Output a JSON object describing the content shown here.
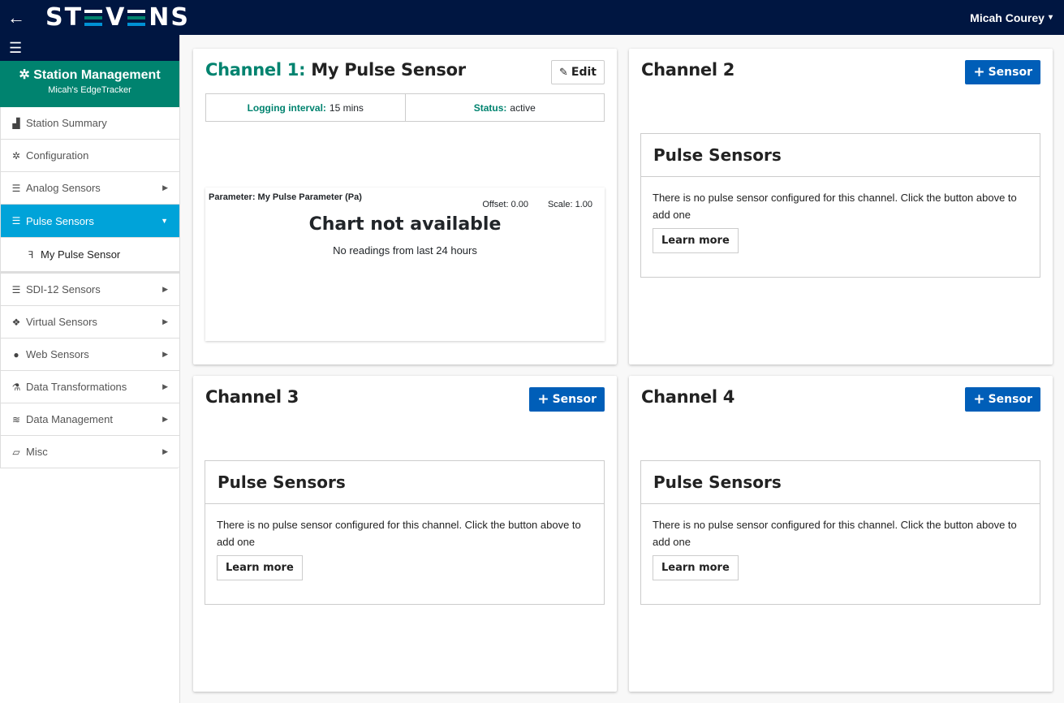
{
  "header": {
    "back_icon": "←",
    "logo_text_left": "ST",
    "logo_text_mid": "V",
    "logo_text_right": "NS",
    "user_name": "Micah Courey",
    "user_caret": "▾",
    "colors": {
      "navy": "#001641",
      "teal": "#00836f",
      "blue": "#005eb8",
      "active": "#00a3d9"
    }
  },
  "sidebar": {
    "menu_icon": "☰",
    "station_title": "Station Management",
    "station_icon": "✲",
    "station_subtitle": "Micah's EdgeTracker",
    "items": [
      {
        "label": "Station Summary",
        "icon": "▟",
        "arrow": ""
      },
      {
        "label": "Configuration",
        "icon": "✲",
        "arrow": ""
      },
      {
        "label": "Analog Sensors",
        "icon": "☰",
        "arrow": "▶"
      },
      {
        "label": "Pulse Sensors",
        "icon": "☰",
        "arrow": "▼"
      },
      {
        "label": "My Pulse Sensor",
        "icon": "ꟻ",
        "arrow": ""
      },
      {
        "label": "SDI-12 Sensors",
        "icon": "☰",
        "arrow": "▶"
      },
      {
        "label": "Virtual Sensors",
        "icon": "❖",
        "arrow": "▶"
      },
      {
        "label": "Web Sensors",
        "icon": "●",
        "arrow": "▶"
      },
      {
        "label": "Data Transformations",
        "icon": "⚗",
        "arrow": "▶"
      },
      {
        "label": "Data Management",
        "icon": "≋",
        "arrow": "▶"
      },
      {
        "label": "Misc",
        "icon": "▱",
        "arrow": "▶"
      }
    ]
  },
  "channel1": {
    "prefix": "Channel 1:",
    "name": "My Pulse Sensor",
    "edit_label": "Edit",
    "edit_icon": "✎",
    "logging_label": "Logging interval:",
    "logging_value": "15 mins",
    "status_label": "Status:",
    "status_value": "active",
    "parameter": "Parameter: My Pulse Parameter (Pa)",
    "offset": "Offset: 0.00",
    "scale": "Scale: 1.00",
    "chart_message": "Chart not available",
    "chart_sub": "No readings from last 24 hours"
  },
  "empty_channels": [
    {
      "title": "Channel 2",
      "add_label": "Sensor",
      "add_icon": "+",
      "panel_title": "Pulse Sensors",
      "message": "There is no pulse sensor configured for this channel. Click the button above to add one",
      "learn_more": "Learn more"
    },
    {
      "title": "Channel 3",
      "add_label": "Sensor",
      "add_icon": "+",
      "panel_title": "Pulse Sensors",
      "message": "There is no pulse sensor configured for this channel. Click the button above to add one",
      "learn_more": "Learn more"
    },
    {
      "title": "Channel 4",
      "add_label": "Sensor",
      "add_icon": "+",
      "panel_title": "Pulse Sensors",
      "message": "There is no pulse sensor configured for this channel. Click the button above to add one",
      "learn_more": "Learn more"
    }
  ]
}
